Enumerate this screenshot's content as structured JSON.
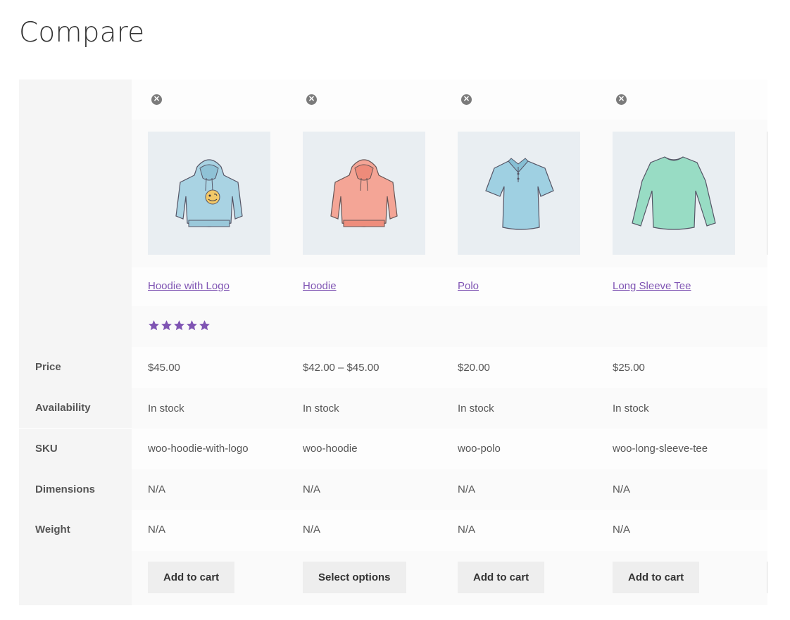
{
  "page": {
    "title": "Compare"
  },
  "labels": {
    "price": "Price",
    "availability": "Availability",
    "sku": "SKU",
    "dimensions": "Dimensions",
    "weight": "Weight"
  },
  "products": [
    {
      "name": "Hoodie with Logo",
      "price": "$45.00",
      "availability": "In stock",
      "sku": "woo-hoodie-with-logo",
      "dimensions": "N/A",
      "weight": "N/A",
      "button": "Add to cart",
      "rating": 5,
      "image": "hoodie-with-logo-icon",
      "color": "#a9d3e3"
    },
    {
      "name": "Hoodie",
      "price": "$42.00 – $45.00",
      "availability": "In stock",
      "sku": "woo-hoodie",
      "dimensions": "N/A",
      "weight": "N/A",
      "button": "Select options",
      "image": "hoodie-icon",
      "color": "#f4a596"
    },
    {
      "name": "Polo",
      "price": "$20.00",
      "availability": "In stock",
      "sku": "woo-polo",
      "dimensions": "N/A",
      "weight": "N/A",
      "button": "Add to cart",
      "image": "polo-shirt-icon",
      "color": "#9fd0e2"
    },
    {
      "name": "Long Sleeve Tee",
      "price": "$25.00",
      "availability": "In stock",
      "sku": "woo-long-sleeve-tee",
      "dimensions": "N/A",
      "weight": "N/A",
      "button": "Add to cart",
      "image": "long-sleeve-tee-icon",
      "color": "#98dcc4"
    }
  ],
  "colors": {
    "link": "#7f54b3",
    "star": "#7f54b3",
    "button_bg": "#eeeeee",
    "image_bg": "#e9eef2"
  },
  "icons": {
    "remove": "remove-x-icon",
    "star": "star-icon"
  }
}
